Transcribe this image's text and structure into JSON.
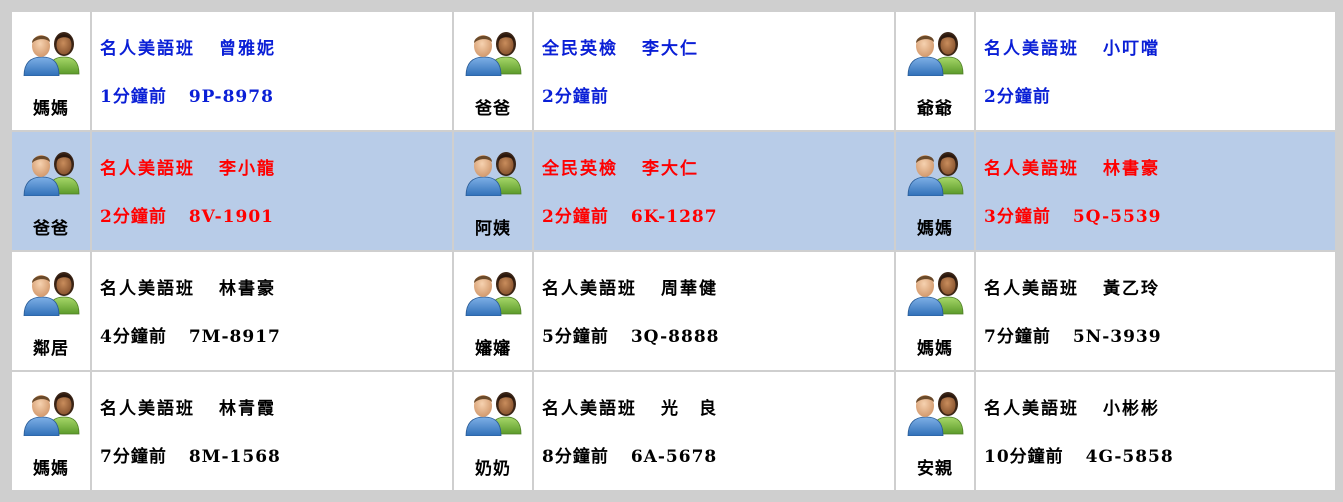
{
  "colors": {
    "blue": "#0a1fd6",
    "red": "#ff0000",
    "black": "#000000",
    "highlight_row": "#b8cce8"
  },
  "rows": [
    {
      "highlight": false,
      "cells": [
        {
          "icon": "parents-avatar-icon",
          "role": "媽媽",
          "class_name": "名人美語班",
          "student": "曾雅妮",
          "time": "1分鐘前",
          "plate": "9P-8978",
          "color": "blue"
        },
        {
          "icon": "parents-avatar-icon",
          "role": "爸爸",
          "class_name": "全民英檢",
          "student": "李大仁",
          "time": "2分鐘前",
          "plate": "",
          "color": "blue"
        },
        {
          "icon": "parents-avatar-icon",
          "role": "爺爺",
          "class_name": "名人美語班",
          "student": "小叮噹",
          "time": "2分鐘前",
          "plate": "",
          "color": "blue"
        }
      ]
    },
    {
      "highlight": true,
      "cells": [
        {
          "icon": "parents-avatar-icon",
          "role": "爸爸",
          "class_name": "名人美語班",
          "student": "李小龍",
          "time": "2分鐘前",
          "plate": "8V-1901",
          "color": "red"
        },
        {
          "icon": "parents-avatar-icon",
          "role": "阿姨",
          "class_name": "全民英檢",
          "student": "李大仁",
          "time": "2分鐘前",
          "plate": "6K-1287",
          "color": "red"
        },
        {
          "icon": "parents-avatar-icon",
          "role": "媽媽",
          "class_name": "名人美語班",
          "student": "林書豪",
          "time": "3分鐘前",
          "plate": "5Q-5539",
          "color": "red"
        }
      ]
    },
    {
      "highlight": false,
      "cells": [
        {
          "icon": "parents-avatar-icon",
          "role": "鄰居",
          "class_name": "名人美語班",
          "student": "林書豪",
          "time": "4分鐘前",
          "plate": "7M-8917",
          "color": "black"
        },
        {
          "icon": "parents-avatar-icon",
          "role": "嬸嬸",
          "class_name": "名人美語班",
          "student": "周華健",
          "time": "5分鐘前",
          "plate": "3Q-8888",
          "color": "black"
        },
        {
          "icon": "parents-avatar-icon",
          "role": "媽媽",
          "class_name": "名人美語班",
          "student": "黃乙玲",
          "time": "7分鐘前",
          "plate": "5N-3939",
          "color": "black"
        }
      ]
    },
    {
      "highlight": false,
      "cells": [
        {
          "icon": "parents-avatar-icon",
          "role": "媽媽",
          "class_name": "名人美語班",
          "student": "林青霞",
          "time": "7分鐘前",
          "plate": "8M-1568",
          "color": "black"
        },
        {
          "icon": "parents-avatar-icon",
          "role": "奶奶",
          "class_name": "名人美語班",
          "student": "光　良",
          "time": "8分鐘前",
          "plate": "6A-5678",
          "color": "black"
        },
        {
          "icon": "parents-avatar-icon",
          "role": "安親",
          "class_name": "名人美語班",
          "student": "小彬彬",
          "time": "10分鐘前",
          "plate": "4G-5858",
          "color": "black"
        }
      ]
    }
  ]
}
